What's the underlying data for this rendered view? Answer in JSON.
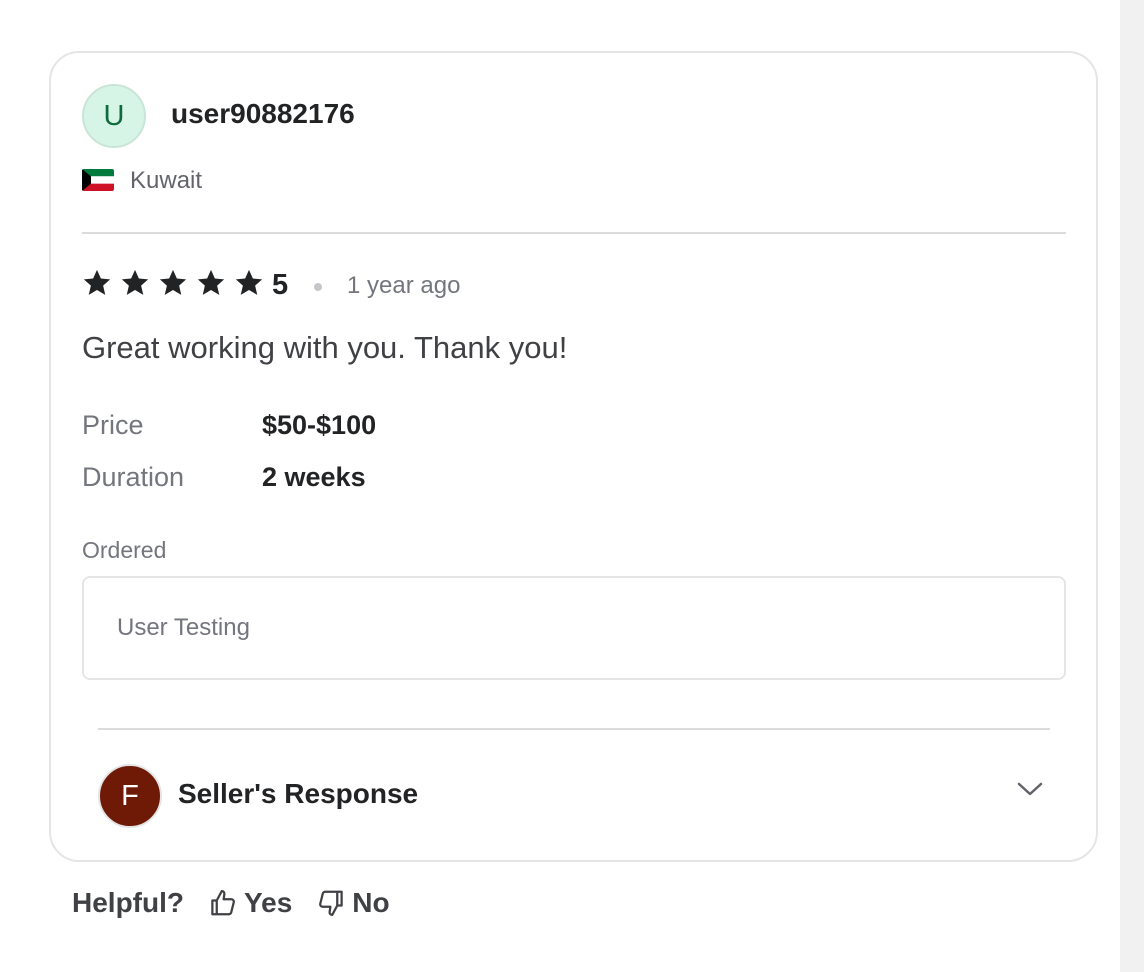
{
  "reviewer": {
    "avatar_initial": "U",
    "username": "user90882176",
    "country": "Kuwait",
    "flag_icon": "kuwait-flag-icon"
  },
  "review": {
    "rating": 5,
    "rating_label": "5",
    "time_ago": "1 year ago",
    "text": "Great working with you. Thank you!"
  },
  "details": {
    "price_label": "Price",
    "price_value": "$50-$100",
    "duration_label": "Duration",
    "duration_value": "2 weeks"
  },
  "ordered": {
    "label": "Ordered",
    "item": "User Testing"
  },
  "seller_response": {
    "avatar_initial": "F",
    "label": "Seller's Response",
    "expanded": false
  },
  "helpful": {
    "question": "Helpful?",
    "yes_label": "Yes",
    "no_label": "No"
  },
  "colors": {
    "star": "#222325",
    "reviewer_avatar_bg": "#d7f5e6",
    "reviewer_avatar_text": "#0e6b3e",
    "seller_avatar_bg": "#6f1a07",
    "border": "#e4e5e7"
  }
}
